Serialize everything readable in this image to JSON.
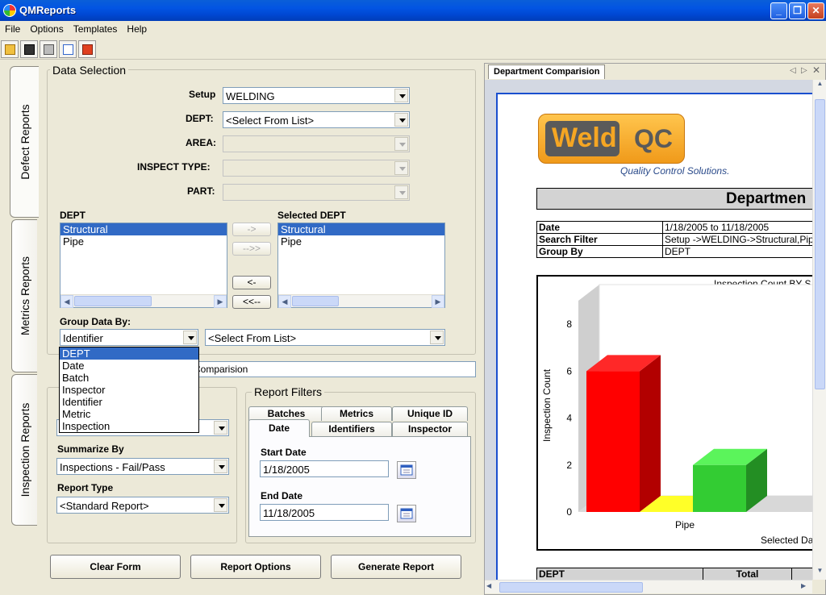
{
  "app": {
    "title": "QMReports"
  },
  "menu": [
    "File",
    "Options",
    "Templates",
    "Help"
  ],
  "left_tabs": [
    "Defect Reports",
    "Metrics Reports",
    "Inspection Reports"
  ],
  "data_selection": {
    "legend": "Data Selection",
    "setup_label": "Setup",
    "setup_value": "WELDING",
    "dept_label": "DEPT:",
    "dept_value": "<Select From List>",
    "area_label": "AREA:",
    "inspect_type_label": "INSPECT TYPE:",
    "part_label": "PART:",
    "available_header": "DEPT",
    "available_items": [
      "Structural",
      "Pipe"
    ],
    "selected_header": "Selected DEPT",
    "selected_items": [
      "Structural",
      "Pipe"
    ],
    "move_buttons": [
      "->",
      "-->>",
      "<-",
      "<<--"
    ],
    "group_by_label": "Group Data By:",
    "group_by_value": "Identifier",
    "group_by_secondary": "<Select From List>",
    "group_by_options": [
      "DEPT",
      "Date",
      "Batch",
      "Inspector",
      "Identifier",
      "Metric",
      "Inspection"
    ],
    "title_fragment": "Comparision"
  },
  "left_lower": {
    "summarize_label": "Summarize By",
    "summarize_value": "Inspections - Fail/Pass",
    "report_type_label": "Report Type",
    "report_type_value": "<Standard Report>"
  },
  "report_filters": {
    "legend": "Report Filters",
    "tabs_row1": [
      "Batches",
      "Metrics",
      "Unique ID"
    ],
    "tabs_row2": [
      "Date",
      "Identifiers",
      "Inspector"
    ],
    "start_label": "Start Date",
    "start_value": "1/18/2005",
    "end_label": "End Date",
    "end_value": "11/18/2005"
  },
  "bottom_buttons": [
    "Clear Form",
    "Report Options",
    "Generate Report"
  ],
  "preview": {
    "tab_label": "Department Comparision",
    "logo_left": "Weld",
    "logo_right": "QC",
    "logo_tagline": "Quality Control Solutions.",
    "heading": "Departmen",
    "meta": [
      {
        "key": "Date",
        "value": "1/18/2005 to 11/18/2005"
      },
      {
        "key": "Search Filter",
        "value": "Setup ->WELDING->Structural,Pip"
      },
      {
        "key": "Group By",
        "value": "DEPT"
      }
    ],
    "table_headers": [
      "DEPT",
      "Total"
    ]
  },
  "chart_data": {
    "type": "bar",
    "title": "Inspection Count BY S",
    "ylabel": "Inspection Count",
    "xlabel": "Selected Da",
    "categories": [
      "Pipe"
    ],
    "series": [
      {
        "values": [
          6
        ],
        "color": "#ff0000"
      },
      {
        "values": [
          0
        ],
        "color": "#e0e000"
      },
      {
        "values": [
          2
        ],
        "color": "#33cc33"
      }
    ],
    "ylim": [
      0,
      9
    ],
    "yticks": [
      0,
      2,
      4,
      6,
      8
    ]
  }
}
